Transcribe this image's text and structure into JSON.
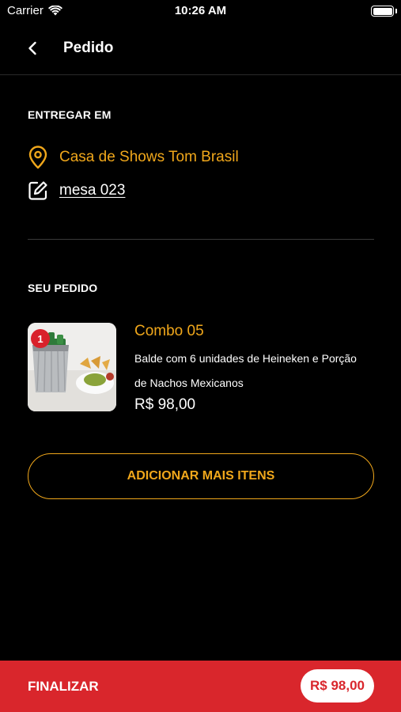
{
  "status_bar": {
    "carrier": "Carrier",
    "time": "10:26 AM",
    "icons": [
      "wifi-icon",
      "battery-icon"
    ]
  },
  "header": {
    "title": "Pedido",
    "back_icon": "chevron-left-icon"
  },
  "delivery": {
    "section_label": "ENTREGAR EM",
    "venue": "Casa de Shows Tom Brasil",
    "venue_icon": "location-pin-icon",
    "table": "mesa 023",
    "table_icon": "edit-icon"
  },
  "order": {
    "section_label": "SEU PEDIDO",
    "items": [
      {
        "quantity": "1",
        "name": "Combo 05",
        "description": "Balde com 6 unidades de Heineken e Porção de Nachos Mexicanos",
        "price": "R$ 98,00"
      }
    ],
    "add_more_label": "ADICIONAR MAIS ITENS"
  },
  "footer": {
    "finalize_label": "FINALIZAR",
    "total": "R$ 98,00"
  },
  "colors": {
    "background": "#000000",
    "accent": "#f0a71b",
    "primary": "#d9262c",
    "text": "#ffffff"
  }
}
